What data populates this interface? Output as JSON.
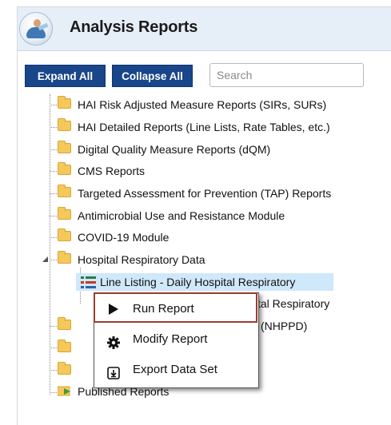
{
  "header": {
    "title": "Analysis Reports",
    "logo_icon": "analysis-logo-icon"
  },
  "toolbar": {
    "expand_label": "Expand All",
    "collapse_label": "Collapse All",
    "search_placeholder": "Search"
  },
  "tree": {
    "folders": [
      {
        "label": "HAI Risk Adjusted Measure Reports (SIRs, SURs)"
      },
      {
        "label": "HAI Detailed Reports (Line Lists, Rate Tables, etc.)"
      },
      {
        "label": "Digital Quality Measure Reports (dQM)"
      },
      {
        "label": "CMS Reports"
      },
      {
        "label": "Targeted Assessment for Prevention (TAP) Reports"
      },
      {
        "label": "Antimicrobial Use and Resistance Module"
      },
      {
        "label": "COVID-19 Module"
      },
      {
        "label": "Hospital Respiratory Data"
      }
    ],
    "selected_child": {
      "label": "Line Listing - Daily Hospital Respiratory"
    },
    "partial_child": {
      "label": "tal Respiratory"
    },
    "partial_folder": {
      "label": "(NHPPD)"
    },
    "published": {
      "label": "Published Reports"
    }
  },
  "context_menu": {
    "items": [
      {
        "label": "Run Report",
        "icon": "play-icon"
      },
      {
        "label": "Modify Report",
        "icon": "gear-icon"
      },
      {
        "label": "Export Data Set",
        "icon": "export-icon"
      }
    ]
  },
  "colors": {
    "button_bg": "#19468a",
    "header_bg": "#e6eef8",
    "selection_bg": "#cfe8fa",
    "highlight_border": "#9b3d30"
  }
}
